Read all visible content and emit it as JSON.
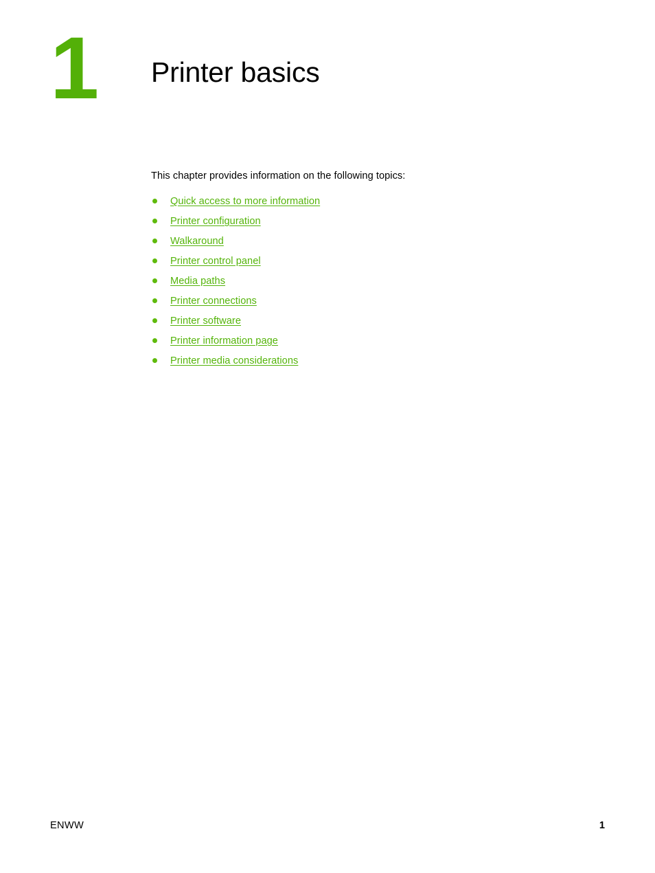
{
  "chapter": {
    "number": "1",
    "title": "Printer basics",
    "number_color": "#53b008"
  },
  "body": {
    "intro": "This chapter provides information on the following topics:",
    "link_color": "#54b40a",
    "bullet_color": "#5fba0c",
    "topics": [
      {
        "label": "Quick access to more information"
      },
      {
        "label": "Printer configuration"
      },
      {
        "label": "Walkaround"
      },
      {
        "label": "Printer control panel"
      },
      {
        "label": "Media paths"
      },
      {
        "label": "Printer connections"
      },
      {
        "label": "Printer software"
      },
      {
        "label": "Printer information page"
      },
      {
        "label": "Printer media considerations"
      }
    ]
  },
  "footer": {
    "left": "ENWW",
    "page_number": "1"
  }
}
